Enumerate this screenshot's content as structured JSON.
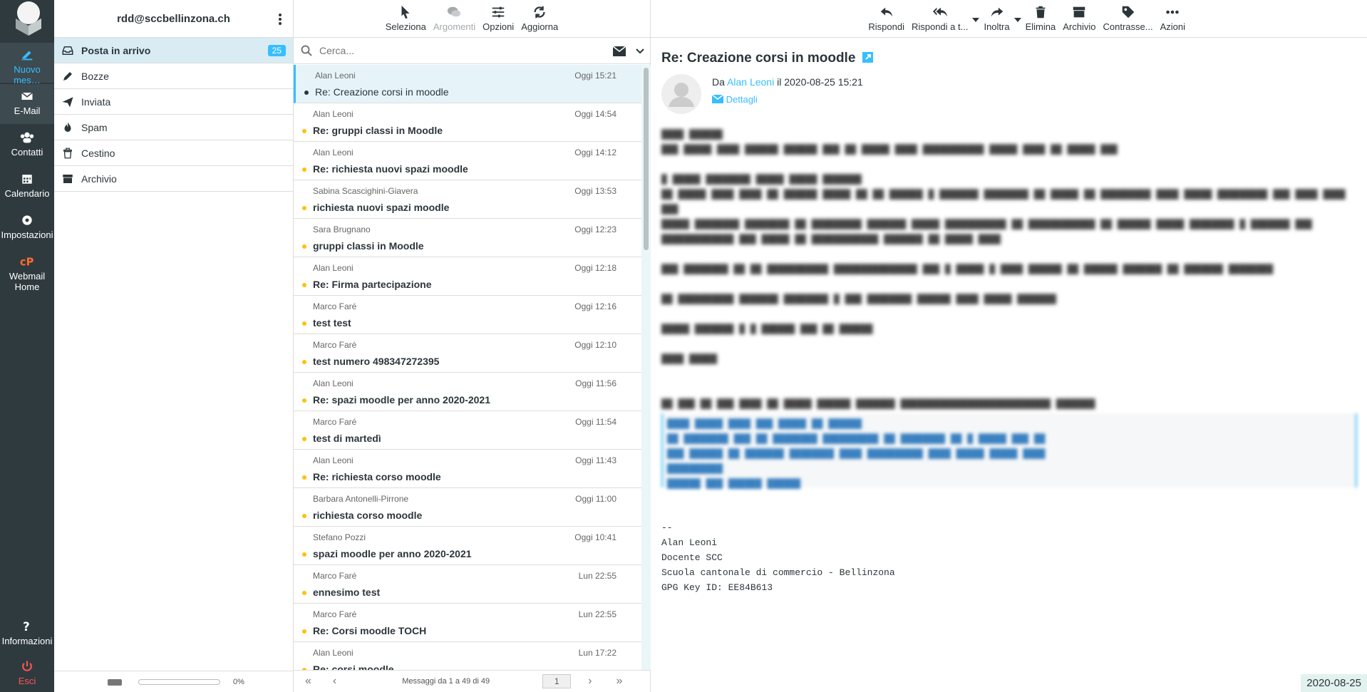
{
  "nav": {
    "compose": "Nuovo mes…",
    "mail": "E-Mail",
    "contacts": "Contatti",
    "calendar": "Calendario",
    "settings": "Impostazioni",
    "webmail": "Webmail",
    "webmail2": "Home",
    "about": "Informazioni",
    "logout": "Esci"
  },
  "account": "rdd@sccbellinzona.ch",
  "folders": [
    {
      "label": "Posta in arrivo",
      "count": "25",
      "icon": "inbox-icon"
    },
    {
      "label": "Bozze",
      "icon": "pencil-icon"
    },
    {
      "label": "Inviata",
      "icon": "paper-plane-icon"
    },
    {
      "label": "Spam",
      "icon": "fire-icon"
    },
    {
      "label": "Cestino",
      "icon": "trash-icon"
    },
    {
      "label": "Archivio",
      "icon": "archive-icon"
    }
  ],
  "quota": "0%",
  "list_toolbar": {
    "select": "Seleziona",
    "threads": "Argomenti",
    "options": "Opzioni",
    "refresh": "Aggiorna"
  },
  "search": {
    "placeholder": "Cerca..."
  },
  "messages": [
    {
      "from": "Alan Leoni",
      "date": "Oggi 15:21",
      "subject": "Re: Creazione corsi in moodle"
    },
    {
      "from": "Alan Leoni",
      "date": "Oggi 14:54",
      "subject": "Re: gruppi classi in Moodle"
    },
    {
      "from": "Alan Leoni",
      "date": "Oggi 14:12",
      "subject": "Re: richiesta nuovi spazi moodle"
    },
    {
      "from": "Sabina Scascighini-Giavera",
      "date": "Oggi 13:53",
      "subject": "richiesta nuovi spazi moodle"
    },
    {
      "from": "Sara Brugnano",
      "date": "Oggi 12:23",
      "subject": "gruppi classi in Moodle"
    },
    {
      "from": "Alan Leoni",
      "date": "Oggi 12:18",
      "subject": "Re: Firma partecipazione"
    },
    {
      "from": "Marco Faré",
      "date": "Oggi 12:16",
      "subject": "test test"
    },
    {
      "from": "Marco Faré",
      "date": "Oggi 12:10",
      "subject": "test numero 498347272395"
    },
    {
      "from": "Alan Leoni",
      "date": "Oggi 11:56",
      "subject": "Re: spazi moodle per anno 2020-2021"
    },
    {
      "from": "Marco Faré",
      "date": "Oggi 11:54",
      "subject": "test di martedì"
    },
    {
      "from": "Alan Leoni",
      "date": "Oggi 11:43",
      "subject": "Re: richiesta corso moodle"
    },
    {
      "from": "Barbara Antonelli-Pirrone",
      "date": "Oggi 11:00",
      "subject": "richiesta corso moodle"
    },
    {
      "from": "Stefano Pozzi",
      "date": "Oggi 10:41",
      "subject": "spazi moodle per anno 2020-2021"
    },
    {
      "from": "Marco Faré",
      "date": "Lun 22:55",
      "subject": "ennesimo test"
    },
    {
      "from": "Marco Faré",
      "date": "Lun 22:55",
      "subject": "Re: Corsi moodle TOCH"
    },
    {
      "from": "Alan Leoni",
      "date": "Lun 17:22",
      "subject": "Re: corsi moodle"
    }
  ],
  "pager": {
    "text": "Messaggi da 1 a 49 di 49",
    "page": "1"
  },
  "msg_toolbar": {
    "reply": "Rispondi",
    "reply_all": "Rispondi a t...",
    "forward": "Inoltra",
    "delete": "Elimina",
    "archive": "Archivio",
    "mark": "Contrasse...",
    "more": "Azioni"
  },
  "message": {
    "subject": "Re: Creazione corsi in moodle",
    "from_prefix": "Da",
    "from": "Alan Leoni",
    "date": "il 2020-08-25 15:21",
    "details": "Dettagli",
    "signature": "--\nAlan Leoni\nDocente SCC\nScuola cantonale di commercio - Bellinzona\nGPG Key ID: EE84B613"
  },
  "datestamp": "2020-08-25"
}
